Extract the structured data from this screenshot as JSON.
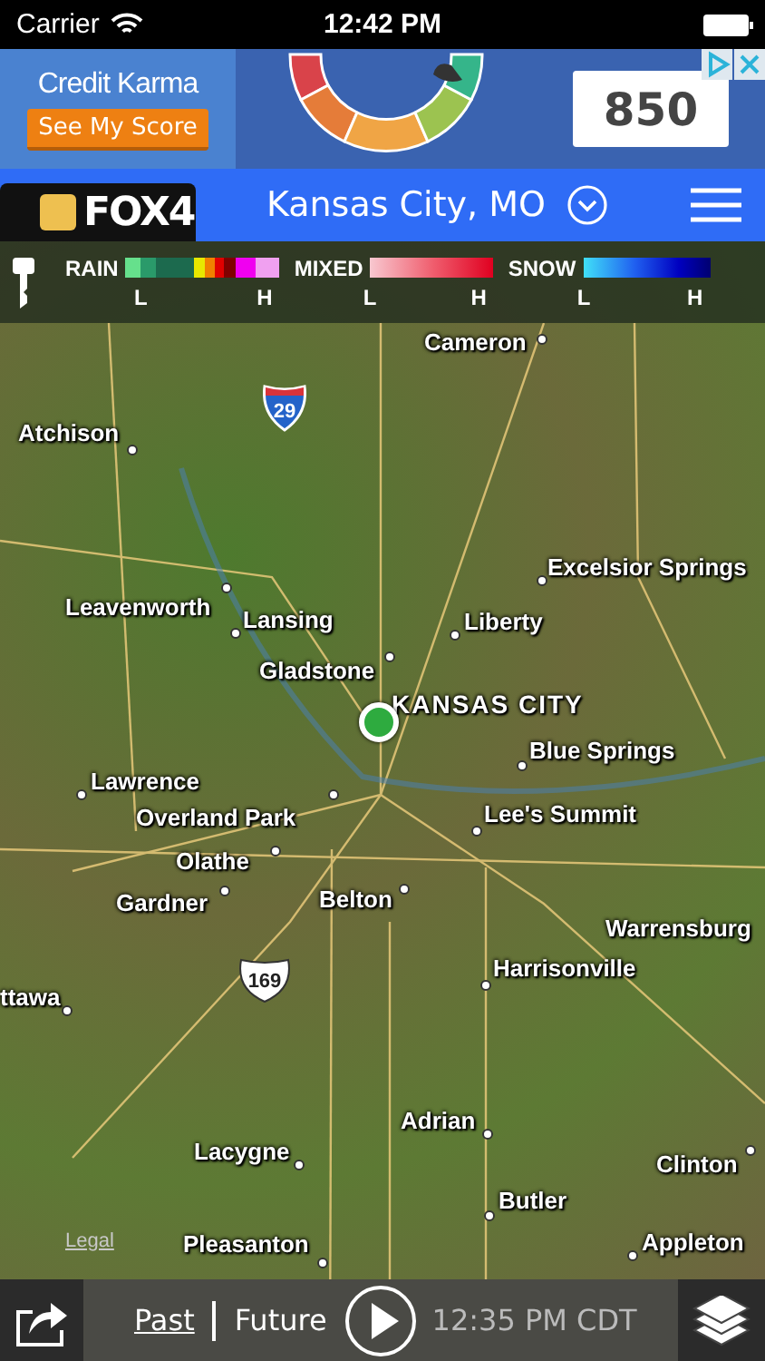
{
  "status_bar": {
    "carrier": "Carrier",
    "time": "12:42 PM"
  },
  "ad": {
    "brand": "Credit Karma",
    "button": "See My Score",
    "score": "850"
  },
  "header": {
    "logo": "FOX4",
    "location": "Kansas City, MO"
  },
  "legend": [
    {
      "kind": "rain",
      "label": "RAIN",
      "low": "L",
      "high": "H"
    },
    {
      "kind": "mixed",
      "label": "MIXED",
      "low": "L",
      "high": "H"
    },
    {
      "kind": "snow",
      "label": "SNOW",
      "low": "L",
      "high": "H"
    }
  ],
  "map": {
    "labels": [
      "Cameron",
      "Atchison",
      "Excelsior Springs",
      "Leavenworth",
      "Lansing",
      "Liberty",
      "Gladstone",
      "KANSAS CITY",
      "Blue Springs",
      "Lawrence",
      "Overland Park",
      "Lee's Summit",
      "Olathe",
      "Gardner",
      "Belton",
      "Warrensburg",
      "Harrisonville",
      "ttawa",
      "Adrian",
      "Lacygne",
      "Clinton",
      "Butler",
      "Pleasanton",
      "Appleton"
    ],
    "shields": [
      {
        "kind": "interstate",
        "text": "29"
      },
      {
        "kind": "us",
        "text": "169"
      }
    ],
    "legal": "Legal"
  },
  "toolbar": {
    "tabs": [
      {
        "label": "Past",
        "selected": true
      },
      {
        "label": "Future",
        "selected": false
      }
    ],
    "time": "12:35 PM CDT"
  }
}
